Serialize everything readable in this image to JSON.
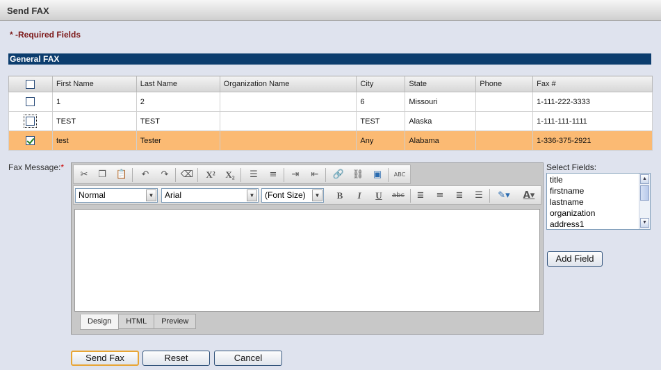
{
  "window": {
    "title": "Send FAX"
  },
  "required_note": "* -Required Fields",
  "section_title": "General FAX",
  "recipients": {
    "columns": [
      "First Name",
      "Last Name",
      "Organization Name",
      "City",
      "State",
      "Phone",
      "Fax #"
    ],
    "rows": [
      {
        "checked": false,
        "first": "1",
        "last": "2",
        "org": "",
        "city": "6",
        "state": "Missouri",
        "phone": "",
        "fax": "1-111-222-3333"
      },
      {
        "checked": false,
        "first": "TEST",
        "last": "TEST",
        "org": "",
        "city": "TEST",
        "state": "Alaska",
        "phone": "",
        "fax": "1-111-111-1111"
      },
      {
        "checked": true,
        "first": "test",
        "last": "Tester",
        "org": "",
        "city": "Any",
        "state": "Alabama",
        "phone": "",
        "fax": "1-336-375-2921"
      }
    ]
  },
  "fax_message": {
    "label": "Fax Message:",
    "required_mark": "*"
  },
  "editor": {
    "toolbar1_icons": [
      "cut-icon",
      "copy-icon",
      "paste-icon",
      "undo-icon",
      "redo-icon",
      "eraser-icon",
      "superscript-icon",
      "subscript-icon",
      "ordered-list-icon",
      "unordered-list-icon",
      "indent-icon",
      "outdent-icon",
      "link-icon",
      "unlink-icon",
      "image-icon",
      "spellcheck-icon"
    ],
    "format_select": "Normal",
    "font_select": "Arial",
    "size_select": "(Font Size)",
    "toolbar2_icons": [
      "bold-icon",
      "italic-icon",
      "underline-icon",
      "strikethrough-icon",
      "align-left-icon",
      "align-center-icon",
      "align-right-icon",
      "justify-icon",
      "highlight-color-icon",
      "font-color-icon"
    ],
    "modes": [
      "Design",
      "HTML",
      "Preview"
    ],
    "active_mode": "Design"
  },
  "select_fields": {
    "label": "Select Fields:",
    "options": [
      "title",
      "firstname",
      "lastname",
      "organization",
      "address1"
    ]
  },
  "buttons": {
    "add_field": "Add Field",
    "send_fax": "Send Fax",
    "reset": "Reset",
    "cancel": "Cancel"
  }
}
